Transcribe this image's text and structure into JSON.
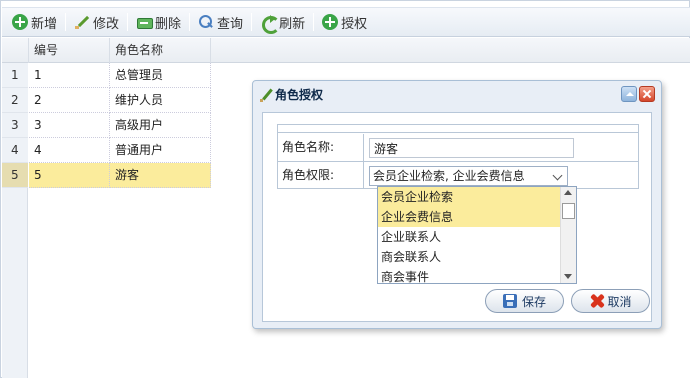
{
  "toolbar": {
    "add_label": "新增",
    "edit_label": "修改",
    "delete_label": "删除",
    "query_label": "查询",
    "refresh_label": "刷新",
    "authorize_label": "授权"
  },
  "grid": {
    "columns": [
      "编号",
      "角色名称"
    ],
    "rows": [
      {
        "rownum": "1",
        "id": "1",
        "name": "总管理员"
      },
      {
        "rownum": "2",
        "id": "2",
        "name": "维护人员"
      },
      {
        "rownum": "3",
        "id": "3",
        "name": "高级用户"
      },
      {
        "rownum": "4",
        "id": "4",
        "name": "普通用户"
      },
      {
        "rownum": "5",
        "id": "5",
        "name": "游客",
        "selected": true
      }
    ]
  },
  "dialog": {
    "title": "角色授权",
    "form": {
      "role_name_label": "角色名称:",
      "role_name_value": "游客",
      "role_perm_label": "角色权限:",
      "role_perm_value": "会员企业检索, 企业会费信息"
    },
    "permission_options": [
      {
        "label": "会员企业检索",
        "selected": true
      },
      {
        "label": "企业会费信息",
        "selected": true
      },
      {
        "label": "企业联系人",
        "selected": false
      },
      {
        "label": "商会联系人",
        "selected": false
      },
      {
        "label": "商会事件",
        "selected": false
      }
    ],
    "save_label": "保存",
    "cancel_label": "取消"
  },
  "colors": {
    "selected_row": "#fbec9c",
    "toolbar_bg": "#e6ecf3",
    "dialog_bg": "#e8eef6"
  }
}
